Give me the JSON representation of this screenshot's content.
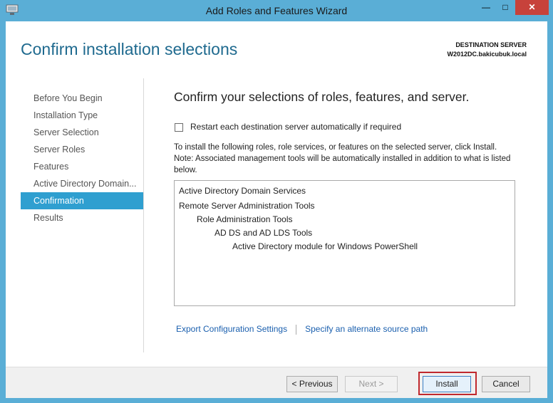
{
  "window": {
    "title": "Add Roles and Features Wizard",
    "accent": "#5aaed6",
    "close_color": "#c7423b",
    "controls": {
      "minimize": "—",
      "maximize": "□",
      "close": "✕"
    }
  },
  "header": {
    "page_title": "Confirm installation selections",
    "destination_label": "DESTINATION SERVER",
    "destination_server": "W2012DC.bakicubuk.local"
  },
  "nav": {
    "items": [
      {
        "label": "Before You Begin"
      },
      {
        "label": "Installation Type"
      },
      {
        "label": "Server Selection"
      },
      {
        "label": "Server Roles"
      },
      {
        "label": "Features"
      },
      {
        "label": "Active Directory Domain..."
      },
      {
        "label": "Confirmation"
      },
      {
        "label": "Results"
      }
    ],
    "active_index": 6
  },
  "content": {
    "heading": "Confirm your selections of roles, features, and server.",
    "restart_label": "Restart each destination server automatically if required",
    "restart_checked": false,
    "info_line1": "To install the following roles, role services, or features on the selected server, click Install.",
    "info_line2": "Note: Associated management tools will be automatically installed in addition to what is listed below.",
    "selections": [
      {
        "label": "Active Directory Domain Services",
        "level": 0
      },
      {
        "label": "Remote Server Administration Tools",
        "level": 0
      },
      {
        "label": "Role Administration Tools",
        "level": 1
      },
      {
        "label": "AD DS and AD LDS Tools",
        "level": 2
      },
      {
        "label": "Active Directory module for Windows PowerShell",
        "level": 3
      }
    ],
    "export_link": "Export Configuration Settings",
    "alt_source_link": "Specify an alternate source path"
  },
  "footer": {
    "previous_label": "< Previous",
    "next_label": "Next >",
    "install_label": "Install",
    "cancel_label": "Cancel"
  }
}
